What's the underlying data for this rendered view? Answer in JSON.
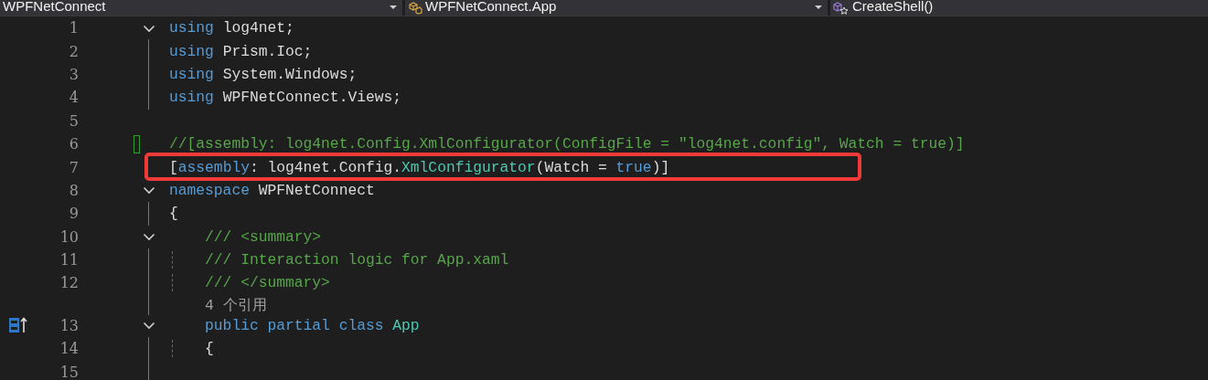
{
  "navigation_bar": [
    {
      "kind": "project",
      "label": "WPFNetConnect"
    },
    {
      "kind": "class",
      "label": "WPFNetConnect.App"
    },
    {
      "kind": "method",
      "label": "CreateShell()"
    }
  ],
  "lines": [
    {
      "kind": "code",
      "number": "1",
      "expanded": true,
      "tokens": [
        {
          "kind": "keyword",
          "text": "using"
        },
        {
          "kind": "plain",
          "text": " log4net;"
        }
      ],
      "children": [
        {
          "kind": "code",
          "number": "2",
          "tokens": [
            {
              "kind": "keyword",
              "text": "using"
            },
            {
              "kind": "plain",
              "text": " Prism.Ioc;"
            }
          ]
        },
        {
          "kind": "code",
          "number": "3",
          "tokens": [
            {
              "kind": "keyword",
              "text": "using"
            },
            {
              "kind": "plain",
              "text": " System.Windows;"
            }
          ]
        },
        {
          "kind": "code",
          "number": "4",
          "tokens": [
            {
              "kind": "keyword",
              "text": "using"
            },
            {
              "kind": "plain",
              "text": " WPFNetConnect.Views;"
            }
          ]
        }
      ]
    },
    {
      "kind": "code",
      "number": "5"
    },
    {
      "kind": "code",
      "number": "6",
      "change_marker": true,
      "tokens": [
        {
          "kind": "comment",
          "text": "//[assembly: log4net.Config.XmlConfigurator(ConfigFile = \"log4net.config\", Watch = true)]"
        }
      ]
    },
    {
      "kind": "code",
      "number": "7",
      "boxed": true,
      "tokens": [
        {
          "kind": "plain",
          "text": "["
        },
        {
          "kind": "keyword",
          "text": "assembly"
        },
        {
          "kind": "plain",
          "text": ": log4net.Config."
        },
        {
          "kind": "type",
          "text": "XmlConfigurator"
        },
        {
          "kind": "plain",
          "text": "(Watch = "
        },
        {
          "kind": "keyword",
          "text": "true"
        },
        {
          "kind": "plain",
          "text": ")]"
        }
      ]
    },
    {
      "kind": "code",
      "number": "8",
      "expanded": true,
      "tokens": [
        {
          "kind": "keyword",
          "text": "namespace"
        },
        {
          "kind": "plain",
          "text": " WPFNetConnect"
        }
      ],
      "children": [
        {
          "kind": "code",
          "number": "9",
          "tokens": [
            {
              "kind": "plain",
              "text": "{"
            }
          ]
        },
        {
          "kind": "code",
          "number": "10",
          "expanded": true,
          "tokens": [
            {
              "kind": "comment",
              "text": "    /// <summary>"
            }
          ],
          "children": [
            {
              "kind": "code",
              "number": "11",
              "tokens": [
                {
                  "kind": "comment",
                  "text": "    /// Interaction logic for App.xaml"
                }
              ]
            },
            {
              "kind": "code",
              "number": "12",
              "tokens": [
                {
                  "kind": "comment",
                  "text": "    /// </summary>"
                }
              ]
            }
          ]
        },
        {
          "kind": "codelens",
          "text": "    4 个引用"
        },
        {
          "kind": "code",
          "number": "13",
          "expanded": true,
          "gutter_icon": true,
          "tokens": [
            {
              "kind": "keyword",
              "text": "    public partial class "
            },
            {
              "kind": "type",
              "text": "App"
            }
          ],
          "children": [
            {
              "kind": "code",
              "number": "14",
              "tokens": [
                {
                  "kind": "plain",
                  "text": "    {"
                }
              ]
            },
            {
              "kind": "code",
              "number": "15"
            }
          ]
        }
      ]
    }
  ]
}
